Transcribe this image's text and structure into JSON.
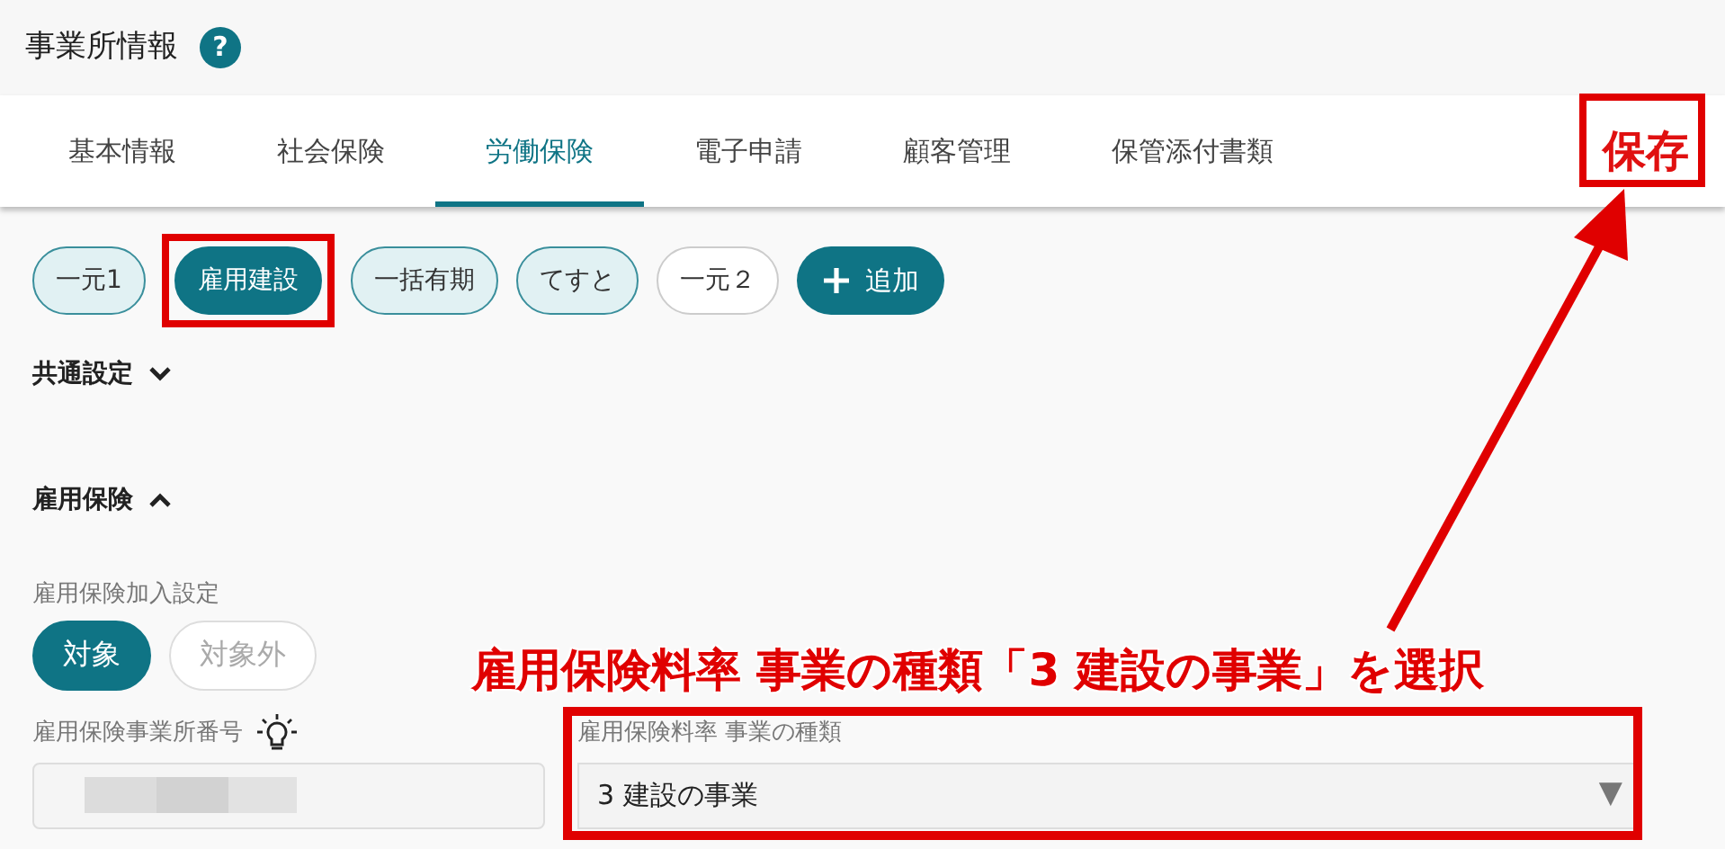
{
  "header": {
    "title": "事業所情報",
    "help": "?"
  },
  "tabs": [
    {
      "label": "基本情報",
      "selected": false
    },
    {
      "label": "社会保険",
      "selected": false
    },
    {
      "label": "労働保険",
      "selected": true
    },
    {
      "label": "電子申請",
      "selected": false
    },
    {
      "label": "顧客管理",
      "selected": false
    },
    {
      "label": "保管添付書類",
      "selected": false
    }
  ],
  "save_button": {
    "label": "保存"
  },
  "chips": [
    {
      "label": "一元1",
      "kind": "tinted",
      "selected": false
    },
    {
      "label": "雇用建設",
      "kind": "tinted",
      "selected": true
    },
    {
      "label": "一括有期",
      "kind": "tinted",
      "selected": false
    },
    {
      "label": "てすと",
      "kind": "tinted",
      "selected": false
    },
    {
      "label": "一元２",
      "kind": "plain",
      "selected": false
    }
  ],
  "add_button": {
    "label": "追加"
  },
  "sections": [
    {
      "title": "共通設定",
      "expanded": false
    },
    {
      "title": "雇用保険",
      "expanded": true
    }
  ],
  "enrollment": {
    "label": "雇用保険加入設定",
    "options": [
      {
        "label": "対象",
        "selected": true
      },
      {
        "label": "対象外",
        "selected": false
      }
    ]
  },
  "office_number": {
    "label": "雇用保険事業所番号"
  },
  "business_type": {
    "label": "雇用保険料率 事業の種類",
    "value": "3 建設の事業",
    "arrow": "▼"
  },
  "annotation": {
    "caption": "雇用保険料率 事業の種類「**3** 建設の事業」を選択"
  }
}
